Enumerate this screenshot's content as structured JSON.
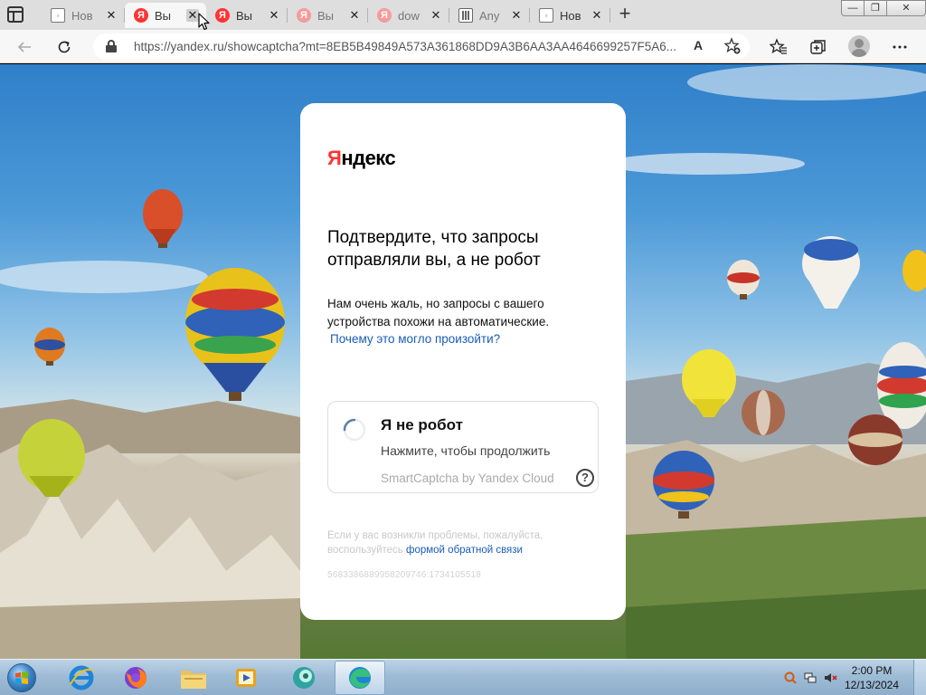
{
  "browser": {
    "tabs": [
      {
        "title": "Нов",
        "favicon": "page-icon",
        "active": false,
        "dim": true
      },
      {
        "title": "Вы",
        "favicon": "yandex-icon",
        "active": true,
        "dim": false
      },
      {
        "title": "Вы",
        "favicon": "yandex-icon",
        "active": false,
        "dim": false
      },
      {
        "title": "Вы",
        "favicon": "yandex-icon",
        "active": false,
        "dim": true
      },
      {
        "title": "dow",
        "favicon": "yandex-icon",
        "active": false,
        "dim": true
      },
      {
        "title": "Any",
        "favicon": "anydesk-icon",
        "active": false,
        "dim": true
      },
      {
        "title": "Нов",
        "favicon": "page-icon",
        "active": false,
        "dim": false
      }
    ],
    "new_tab_glyph": "+",
    "url": "https://yandex.ru/showcaptcha?mt=8EB5B49849A573A361868DD9A3B6AA3AA4646699257F5A6...",
    "read_aloud_glyph": "A",
    "window_buttons": {
      "minimize": "—",
      "maximize": "❐",
      "close": "✕"
    }
  },
  "captcha": {
    "logo_first": "Я",
    "logo_rest": "ндекс",
    "heading": "Подтвердите, что запросы отправляли вы, а не робот",
    "description": "Нам очень жаль, но запросы с вашего устройства похожи на автоматические.",
    "why_link": "Почему это могло произойти?",
    "checkbox_label": "Я не робот",
    "checkbox_hint": "Нажмите, чтобы продолжить",
    "provider": "SmartCaptcha by Yandex Cloud",
    "help_glyph": "?",
    "problem_text": "Если у вас возникли проблемы, пожалуйста, воспользуйтесь",
    "feedback_link": "формой обратной связи",
    "request_id": "5683386889958209746:1734105518"
  },
  "taskbar": {
    "apps": [
      "internet-explorer-icon",
      "firefox-icon",
      "file-explorer-icon",
      "media-player-icon",
      "app-icon",
      "edge-icon"
    ],
    "active_app": "edge-icon",
    "clock_time": "2:00 PM",
    "clock_date": "12/13/2024"
  },
  "colors": {
    "yandex_red": "#ff3333",
    "link_blue": "#1a5cb8",
    "card_background": "#ffffff"
  }
}
